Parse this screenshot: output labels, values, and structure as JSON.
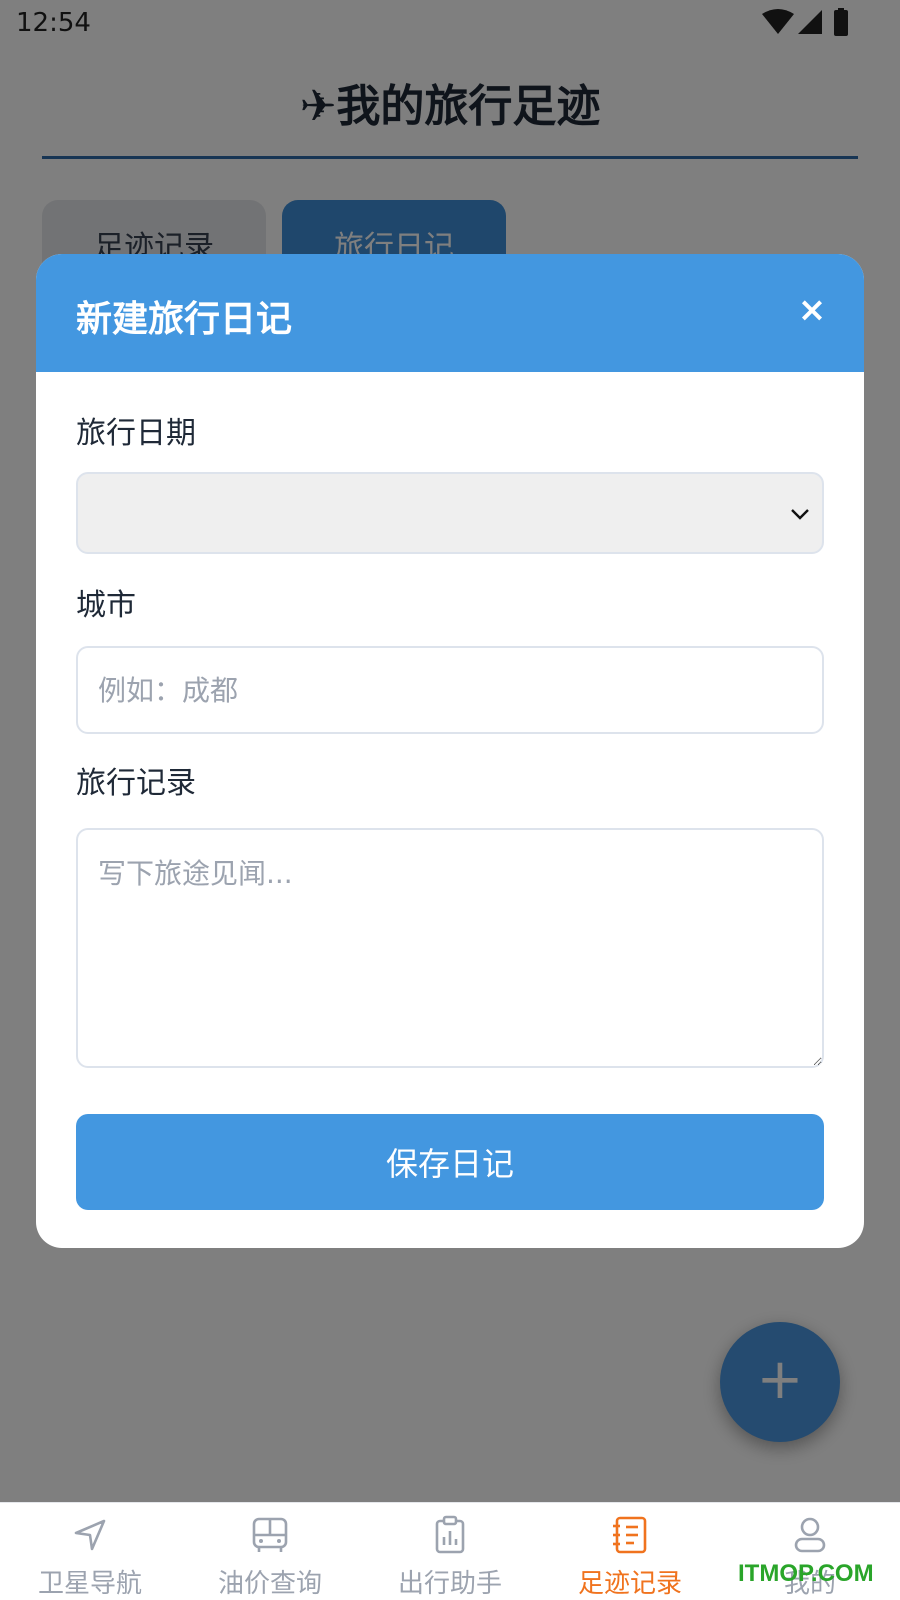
{
  "status_bar": {
    "time": "12:54"
  },
  "header": {
    "title": "✈我的旅行足迹"
  },
  "tabs": [
    {
      "label": "足迹记录"
    },
    {
      "label": "旅行日记"
    }
  ],
  "fab": {
    "label": "+"
  },
  "modal": {
    "title": "新建旅行日记",
    "close_label": "×",
    "date_label": "旅行日期",
    "date_value": "",
    "city_label": "城市",
    "city_placeholder": "例如：成都",
    "notes_label": "旅行记录",
    "notes_placeholder": "写下旅途见闻...",
    "save_label": "保存日记"
  },
  "bottom_nav": {
    "items": [
      {
        "label": "卫星导航",
        "icon": "navigation-arrow-icon"
      },
      {
        "label": "油价查询",
        "icon": "bus-icon"
      },
      {
        "label": "出行助手",
        "icon": "clipboard-chart-icon"
      },
      {
        "label": "足迹记录",
        "icon": "notebook-icon",
        "active": true
      },
      {
        "label": "我的",
        "icon": "user-icon"
      }
    ]
  },
  "watermark": "ITMOP.COM",
  "colors": {
    "primary": "#4397e0",
    "active_nav": "#f0731e",
    "inactive_nav": "#9ca3af"
  }
}
